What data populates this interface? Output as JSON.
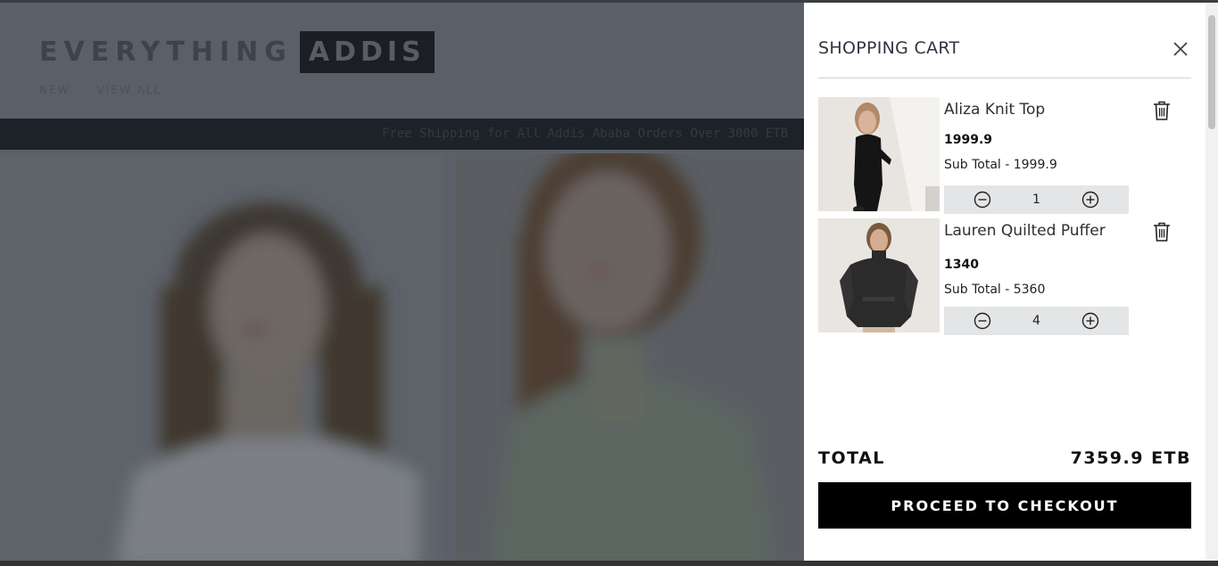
{
  "background": {
    "logo_primary": "EVERYTHING",
    "logo_secondary": "ADDIS",
    "nav": [
      "NEW",
      "VIEW ALL"
    ],
    "banner_text": "Free Shipping for All Addis Ababa Orders Over 3000 ETB"
  },
  "cart": {
    "title": "SHOPPING CART",
    "items": [
      {
        "name": "Aliza Knit Top",
        "price": "1999.9",
        "subtotal": "Sub Total - 1999.9",
        "quantity": "1"
      },
      {
        "name": "Lauren Quilted Puffer",
        "price": "1340",
        "subtotal": "Sub Total - 5360",
        "quantity": "4"
      }
    ],
    "total_label": "TOTAL",
    "total_value": "7359.9 ETB",
    "checkout_label": "PROCEED TO CHECKOUT"
  },
  "colors": {
    "overlay": "#5b6068",
    "drawer_bg": "#ffffff",
    "qty_bg": "#e4e5e6",
    "checkout_bg": "#000000"
  },
  "icons": [
    "close-icon",
    "trash-icon",
    "minus-circle-icon",
    "plus-circle-icon"
  ]
}
